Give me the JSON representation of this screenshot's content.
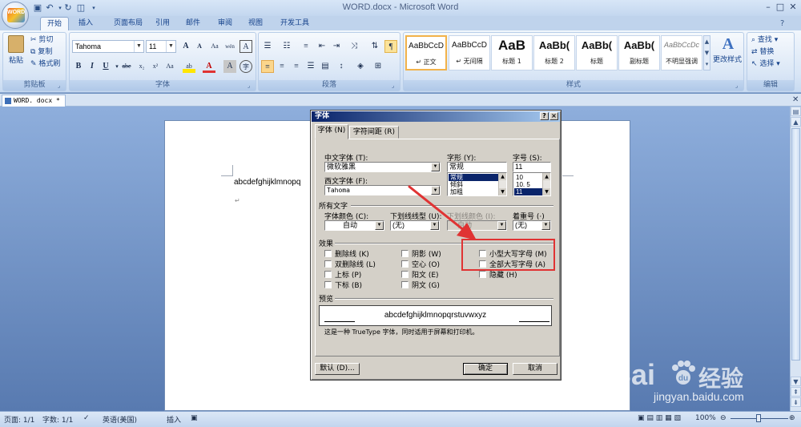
{
  "window": {
    "title": "WORD.docx - Microsoft Word",
    "office_button_logo": "WORD"
  },
  "tabs": [
    "开始",
    "插入",
    "页面布局",
    "引用",
    "邮件",
    "审阅",
    "视图",
    "开发工具"
  ],
  "clipboard": {
    "paste": "粘贴",
    "cut": "剪切",
    "copy": "复制",
    "format_painter": "格式刷",
    "group_label": "剪贴板"
  },
  "font_group": {
    "font_name": "Tahoma",
    "font_size": "11",
    "grow": "A",
    "shrink": "A",
    "clear": "Aa",
    "phonetic": "wén",
    "border_char": "A",
    "bold": "B",
    "italic": "I",
    "underline": "U",
    "strike": "abe",
    "subscript": "x₂",
    "superscript": "x²",
    "change_case": "Aa",
    "highlight": "ab",
    "font_color": "A",
    "char_shading": "A",
    "enclose": "字",
    "group_label": "字体"
  },
  "paragraph_group": {
    "group_label": "段落"
  },
  "styles_group": {
    "items": [
      {
        "sample": "AaBbCcD",
        "name": "↵ 正文"
      },
      {
        "sample": "AaBbCcD",
        "name": "↵ 无间隔"
      },
      {
        "sample": "AaB",
        "name": "标题 1"
      },
      {
        "sample": "AaBb(",
        "name": "标题 2"
      },
      {
        "sample": "AaBb(",
        "name": "标题"
      },
      {
        "sample": "AaBb(",
        "name": "副标题"
      },
      {
        "sample": "AaBbCcDc",
        "name": "不明显强调"
      }
    ],
    "change_styles": "更改样式",
    "group_label": "样式"
  },
  "editing_group": {
    "find": "查找",
    "replace": "替换",
    "select": "选择",
    "group_label": "编辑"
  },
  "document": {
    "tab_name": "WORD. docx *",
    "body_text": "abcdefghijklmnopq",
    "paragraph_mark": "↵"
  },
  "status": {
    "page": "页面: 1/1",
    "words": "字数: 1/1",
    "language": "英语(美国)",
    "insert": "插入",
    "zoom": "100%"
  },
  "dialog": {
    "title": "字体",
    "help": "?",
    "close": "×",
    "tab_font": "字体 (N)",
    "tab_spacing": "字符间距 (R)",
    "cn_font_label": "中文字体 (T):",
    "cn_font_value": "微软雅黑",
    "latin_font_label": "西文字体 (F):",
    "latin_font_value": "Tahoma",
    "style_label": "字形 (Y):",
    "style_value": "常规",
    "style_list": [
      "常规",
      "倾斜",
      "加粗"
    ],
    "size_label": "字号 (S):",
    "size_value": "11",
    "size_list": [
      "10",
      "10. 5",
      "11"
    ],
    "all_text": "所有文字",
    "color_label": "字体颜色 (C):",
    "color_value": "自动",
    "underline_label": "下划线线型 (U):",
    "underline_value": "(无)",
    "underline_color_label": "下划线颜色 (I):",
    "underline_color_value": "自动",
    "emphasis_label": "着重号 (·)",
    "emphasis_value": "(无)",
    "effects": "效果",
    "effects_items": {
      "strikethrough": "删除线 (K)",
      "double_strike": "双删除线 (L)",
      "superscript": "上标 (P)",
      "subscript": "下标 (B)",
      "shadow": "阴影 (W)",
      "outline": "空心 (O)",
      "emboss": "阳文 (E)",
      "engrave": "阴文 (G)",
      "small_caps": "小型大写字母 (M)",
      "all_caps": "全部大写字母 (A)",
      "hidden": "隐藏 (H)"
    },
    "preview_label": "预览",
    "preview_text": "abcdefghijklmnopqrstuvwxyz",
    "note": "这是一种 TrueType 字体，同时适用于屏幕和打印机。",
    "default_button": "默认 (D)...",
    "ok_button": "确定",
    "cancel_button": "取消"
  },
  "watermark": {
    "logo": "Bai",
    "logo2": "du",
    "cn": "经验",
    "url": "jingyan.baidu.com"
  },
  "colors": {
    "highlight_box": "#e03333",
    "arrow": "#e03333",
    "dialog_title": "#0a246a"
  }
}
